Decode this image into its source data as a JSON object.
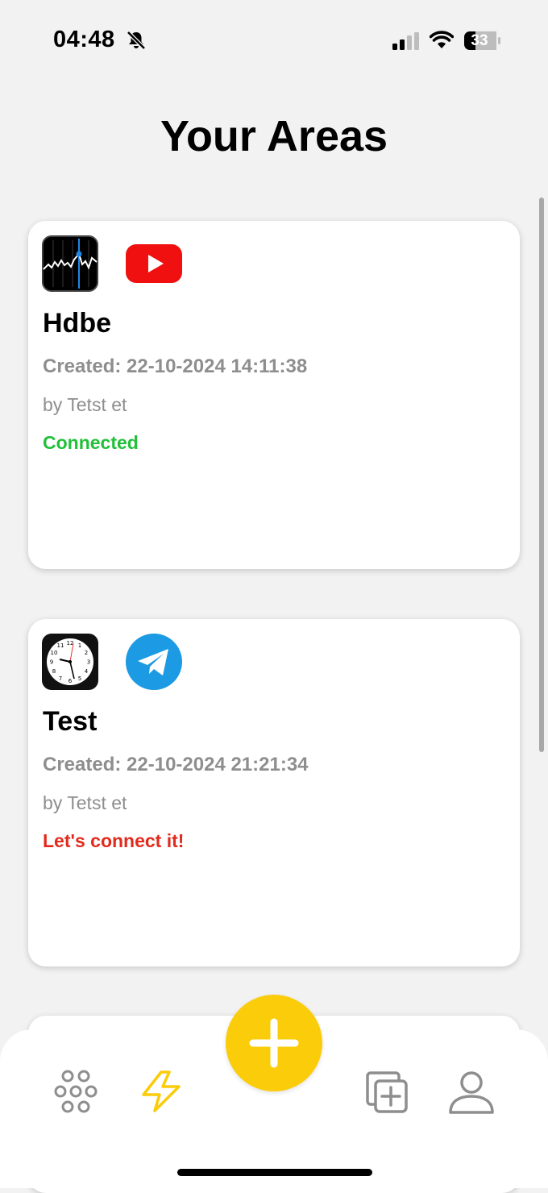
{
  "status_bar": {
    "time": "04:48",
    "battery": "33"
  },
  "page": {
    "title": "Your Areas"
  },
  "areas": [
    {
      "action_icon": "stocks-app-icon",
      "reaction_icon": "youtube-icon",
      "title": "Hdbe",
      "created": "Created: 22-10-2024 14:11:38",
      "author": "by Tetst et",
      "status": "Connected",
      "status_color": "#22c03a"
    },
    {
      "action_icon": "clock-app-icon",
      "reaction_icon": "telegram-icon",
      "title": "Test",
      "created": "Created: 22-10-2024 21:21:34",
      "author": "by Tetst et",
      "status": "Let's connect it!",
      "status_color": "#e22a1d"
    }
  ],
  "tab_bar": {
    "tabs": [
      "home-grid-icon",
      "areas-lightning-icon",
      "create-area-icon",
      "profile-icon"
    ],
    "active_tab": "areas-lightning-icon",
    "accent_color": "#fbcc0a"
  }
}
